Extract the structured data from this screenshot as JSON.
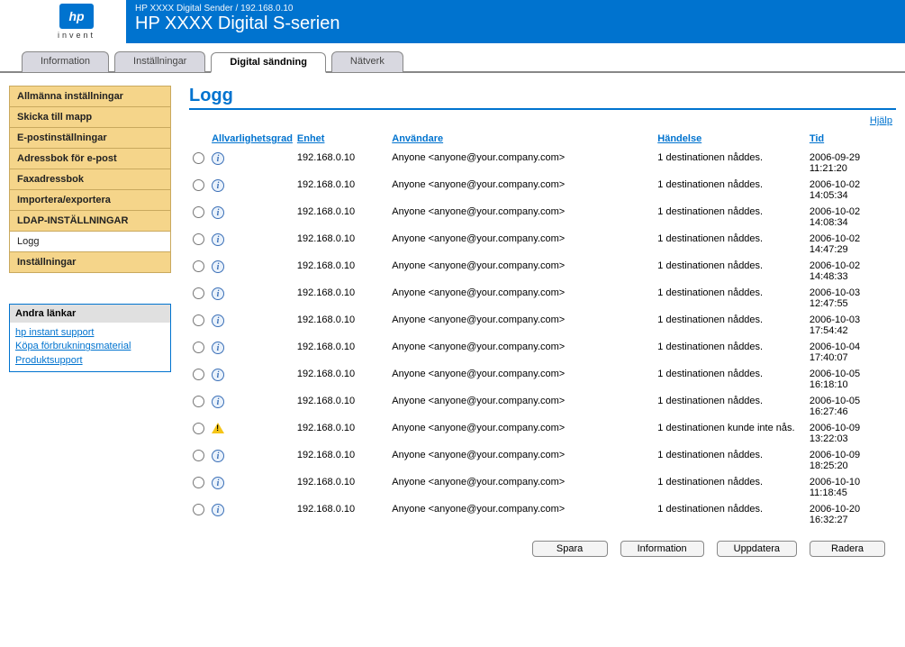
{
  "logo_sub": "invent",
  "banner_top": "HP XXXX Digital Sender / 192.168.0.10",
  "banner_title": "HP XXXX Digital S-serien",
  "tabs": [
    {
      "label": "Information",
      "active": false
    },
    {
      "label": "Inställningar",
      "active": false
    },
    {
      "label": "Digital sändning",
      "active": true
    },
    {
      "label": "Nätverk",
      "active": false
    }
  ],
  "sidebar": {
    "items": [
      {
        "label": "Allmänna inställningar",
        "active": false
      },
      {
        "label": "Skicka till mapp",
        "active": false
      },
      {
        "label": "E-postinställningar",
        "active": false
      },
      {
        "label": "Adressbok för e-post",
        "active": false
      },
      {
        "label": "Faxadressbok",
        "active": false
      },
      {
        "label": "Importera/exportera",
        "active": false
      },
      {
        "label": "LDAP-INSTÄLLNINGAR",
        "active": false
      },
      {
        "label": "Logg",
        "active": true
      },
      {
        "label": "Inställningar",
        "active": false
      }
    ]
  },
  "other_links": {
    "header": "Andra länkar",
    "links": [
      "hp instant support",
      "Köpa förbrukningsmaterial",
      "Produktsupport"
    ]
  },
  "page_title": "Logg",
  "help_label": "Hjälp",
  "columns": {
    "severity": "Allvarlighetsgrad",
    "device": "Enhet",
    "user": "Användare",
    "event": "Händelse",
    "time": "Tid"
  },
  "rows": [
    {
      "sev": "info",
      "device": "192.168.0.10",
      "user": "Anyone <anyone@your.company.com>",
      "event": "1 destinationen nåddes.",
      "time": "2006-09-29 11:21:20"
    },
    {
      "sev": "info",
      "device": "192.168.0.10",
      "user": "Anyone <anyone@your.company.com>",
      "event": "1 destinationen nåddes.",
      "time": "2006-10-02 14:05:34"
    },
    {
      "sev": "info",
      "device": "192.168.0.10",
      "user": "Anyone <anyone@your.company.com>",
      "event": "1 destinationen nåddes.",
      "time": "2006-10-02 14:08:34"
    },
    {
      "sev": "info",
      "device": "192.168.0.10",
      "user": "Anyone <anyone@your.company.com>",
      "event": "1 destinationen nåddes.",
      "time": "2006-10-02 14:47:29"
    },
    {
      "sev": "info",
      "device": "192.168.0.10",
      "user": "Anyone <anyone@your.company.com>",
      "event": "1 destinationen nåddes.",
      "time": "2006-10-02 14:48:33"
    },
    {
      "sev": "info",
      "device": "192.168.0.10",
      "user": "Anyone <anyone@your.company.com>",
      "event": "1 destinationen nåddes.",
      "time": "2006-10-03 12:47:55"
    },
    {
      "sev": "info",
      "device": "192.168.0.10",
      "user": "Anyone <anyone@your.company.com>",
      "event": "1 destinationen nåddes.",
      "time": "2006-10-03 17:54:42"
    },
    {
      "sev": "info",
      "device": "192.168.0.10",
      "user": "Anyone <anyone@your.company.com>",
      "event": "1 destinationen nåddes.",
      "time": "2006-10-04 17:40:07"
    },
    {
      "sev": "info",
      "device": "192.168.0.10",
      "user": "Anyone <anyone@your.company.com>",
      "event": "1 destinationen nåddes.",
      "time": "2006-10-05 16:18:10"
    },
    {
      "sev": "info",
      "device": "192.168.0.10",
      "user": "Anyone <anyone@your.company.com>",
      "event": "1 destinationen nåddes.",
      "time": "2006-10-05 16:27:46"
    },
    {
      "sev": "warn",
      "device": "192.168.0.10",
      "user": "Anyone <anyone@your.company.com>",
      "event": "1 destinationen kunde inte nås.",
      "time": "2006-10-09 13:22:03"
    },
    {
      "sev": "info",
      "device": "192.168.0.10",
      "user": "Anyone <anyone@your.company.com>",
      "event": "1 destinationen nåddes.",
      "time": "2006-10-09 18:25:20"
    },
    {
      "sev": "info",
      "device": "192.168.0.10",
      "user": "Anyone <anyone@your.company.com>",
      "event": "1 destinationen nåddes.",
      "time": "2006-10-10 11:18:45"
    },
    {
      "sev": "info",
      "device": "192.168.0.10",
      "user": "Anyone <anyone@your.company.com>",
      "event": "1 destinationen nåddes.",
      "time": "2006-10-20 16:32:27"
    }
  ],
  "buttons": {
    "save": "Spara",
    "information": "Information",
    "refresh": "Uppdatera",
    "delete": "Radera"
  }
}
